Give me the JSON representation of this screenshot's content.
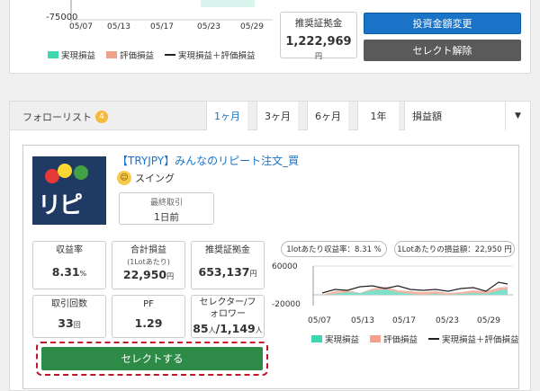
{
  "top_card": {
    "y_min_label": "-75000",
    "x_labels": [
      "05/07",
      "05/13",
      "05/17",
      "05/23",
      "05/29"
    ],
    "legend": [
      {
        "label": "実現損益",
        "color": "#3fd6b0"
      },
      {
        "label": "評価損益",
        "color": "#f2a08c"
      },
      {
        "label": "実現損益＋評価損益",
        "color": "#222222"
      }
    ],
    "margin_label": "推奨証拠金",
    "margin_value": "1,222,969",
    "margin_unit": "円",
    "change_amount_button": "投資金額変更",
    "deselect_button": "セレクト解除"
  },
  "follow_list": {
    "label": "フォローリスト",
    "count": "4",
    "tabs": [
      {
        "label": "1ヶ月",
        "active": true
      },
      {
        "label": "3ヶ月",
        "active": false
      },
      {
        "label": "6ヶ月",
        "active": false
      },
      {
        "label": "1年",
        "active": false
      }
    ],
    "sort_value": "損益額",
    "sort_arrow": "▼"
  },
  "strategy": {
    "logo_text": "リピ",
    "title": "【TRYJPY】みんなのリピート注文_買",
    "type": "スイング",
    "type_icon": "☺",
    "last_trade_label": "最終取引",
    "last_trade_value": "1日前",
    "stats": {
      "return_rate_label": "収益率",
      "return_rate_value": "8.31",
      "return_rate_unit": "%",
      "total_pl_label": "合計損益",
      "total_pl_sub": "(1Lotあたり)",
      "total_pl_value": "22,950",
      "total_pl_unit": "円",
      "rec_margin_label": "推奨証拠金",
      "rec_margin_value": "653,137",
      "rec_margin_unit": "円",
      "trade_count_label": "取引回数",
      "trade_count_value": "33",
      "trade_count_unit": "回",
      "pf_label": "PF",
      "pf_value": "1.29",
      "selector_label": "セレクター/フォロワー",
      "selector_value": "85",
      "selector_unit1": "人",
      "follower_value": "1,149",
      "follower_unit2": "人"
    },
    "pill_return": "1lotあたり収益率：8.31 %",
    "pill_pl": "1Lotあたりの損益額：22,950 円",
    "chart_y_top": "60000",
    "chart_y_bottom": "-20000",
    "chart_x_labels": [
      "05/07",
      "05/13",
      "05/17",
      "05/23",
      "05/29"
    ],
    "legend": [
      {
        "label": "実現損益",
        "color": "#3fd6b0"
      },
      {
        "label": "評価損益",
        "color": "#f2a08c"
      },
      {
        "label": "実現損益＋評価損益",
        "color": "#222222"
      }
    ],
    "select_button": "セレクトする"
  }
}
